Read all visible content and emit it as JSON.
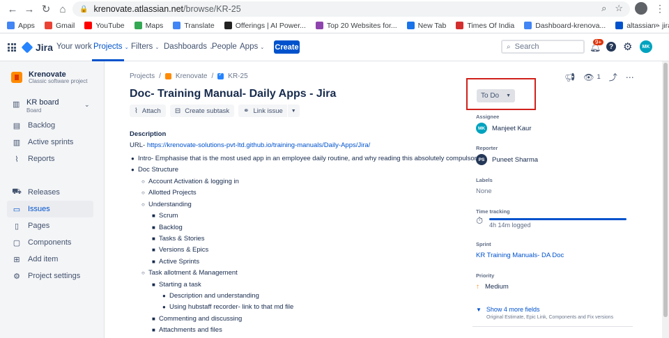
{
  "browser": {
    "url_host": "krenovate.atlassian.net",
    "url_path": "/browse/KR-25",
    "bookmarks": [
      {
        "label": "Apps",
        "color": "#4285f4"
      },
      {
        "label": "Gmail",
        "color": "#ea4335"
      },
      {
        "label": "YouTube",
        "color": "#ff0000"
      },
      {
        "label": "Maps",
        "color": "#34a853"
      },
      {
        "label": "Translate",
        "color": "#4285f4"
      },
      {
        "label": "Offerings | AI Power...",
        "color": "#222222"
      },
      {
        "label": "Top 20 Websites for...",
        "color": "#8e44ad"
      },
      {
        "label": "New Tab",
        "color": "#1a73e8"
      },
      {
        "label": "Times Of India",
        "color": "#d32f2f"
      },
      {
        "label": "Dashboard-krenova...",
        "color": "#4285f4"
      },
      {
        "label": "altassian - jira",
        "color": "#0052cc"
      }
    ],
    "more": "»"
  },
  "topnav": {
    "logo": "Jira",
    "your_work": "Your work",
    "projects": "Projects",
    "filters": "Filters",
    "dashboards": "Dashboards",
    "people": "People",
    "apps": "Apps",
    "create": "Create",
    "search_placeholder": "Search",
    "notif_count": "9+",
    "help": "?",
    "avatar_initials": "MK"
  },
  "sidebar": {
    "project_name": "Krenovate",
    "project_type": "Classic software project",
    "board_label": "KR board",
    "board_sub": "Board",
    "items": [
      {
        "label": "Backlog",
        "icon": "▤"
      },
      {
        "label": "Active sprints",
        "icon": "▥"
      },
      {
        "label": "Reports",
        "icon": "⌇"
      },
      {
        "label": "Releases",
        "icon": "⛟"
      },
      {
        "label": "Issues",
        "icon": "▭"
      },
      {
        "label": "Pages",
        "icon": "▯"
      },
      {
        "label": "Components",
        "icon": "▢"
      },
      {
        "label": "Add item",
        "icon": "⊞"
      },
      {
        "label": "Project settings",
        "icon": "⚙"
      }
    ]
  },
  "issue": {
    "breadcrumb_projects": "Projects",
    "breadcrumb_project": "Krenovate",
    "breadcrumb_key": "KR-25",
    "title": "Doc- Training Manual- Daily Apps - Jira",
    "attach": "Attach",
    "create_subtask": "Create subtask",
    "link_issue": "Link issue",
    "description_label": "Description",
    "url_prefix": "URL- ",
    "url": "https://krenovate-solutions-pvt-ltd.github.io/training-manuals/Daily-Apps/Jira/",
    "outline": [
      "Intro- Emphasise that is the most used app in an employee daily routine, and why reading this absolutely compulsory",
      "Doc Structure",
      "Account Activation & logging in",
      "Allotted Projects",
      "Understanding",
      "Scrum",
      "Backlog",
      "Tasks & Stories",
      "Versions & Epics",
      "Active Sprints",
      "Task allotment & Management",
      "Starting a task",
      "Description and understanding",
      "Using hubstaff recorder- link to that md file",
      "Commenting and discussing",
      "Attachments and files"
    ]
  },
  "details": {
    "watch_count": "1",
    "status": "To Do",
    "assignee_label": "Assignee",
    "assignee": "Manjeet Kaur",
    "assignee_initials": "MK",
    "reporter_label": "Reporter",
    "reporter": "Puneet Sharma",
    "reporter_initials": "PS",
    "labels_label": "Labels",
    "labels": "None",
    "time_label": "Time tracking",
    "time_logged": "4h 14m logged",
    "sprint_label": "Sprint",
    "sprint": "KR Training Manuals- DA Doc",
    "priority_label": "Priority",
    "priority": "Medium",
    "show_more": "Show 4 more fields",
    "show_more_sub": "Original Estimate, Epic Link, Components and Fix versions"
  },
  "colors": {
    "accent": "#0052cc",
    "highlight_box": "#d0201a",
    "assignee_avatar": "#00a3bf",
    "reporter_avatar": "#253858"
  }
}
